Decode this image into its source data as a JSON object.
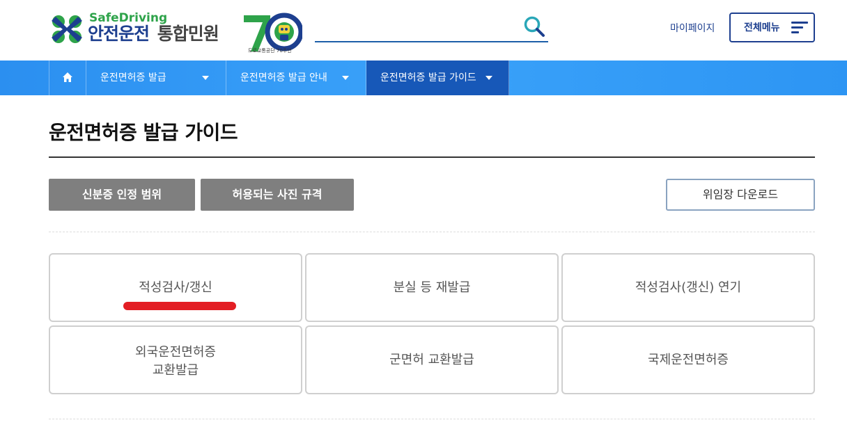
{
  "header": {
    "logo_en": "SafeDriving",
    "logo_ko_main": "안전운전",
    "logo_ko_sub": "통합민원",
    "logo_badge_caption": "도로교통공단 70주년",
    "search_placeholder": "",
    "search_value": "",
    "mypage_label": "마이페이지",
    "allmenu_label": "전체메뉴"
  },
  "nav": {
    "home_icon": "home-icon",
    "items": [
      {
        "label": "운전면허증 발급"
      },
      {
        "label": "운전면허증 발급 안내"
      },
      {
        "label": "운전면허증 발급 가이드"
      }
    ]
  },
  "main": {
    "title": "운전면허증 발급 가이드",
    "buttons": {
      "id_range": "신분증 인정 범위",
      "photo_spec": "허용되는 사진 규격",
      "proxy_download": "위임장 다운로드"
    },
    "cards": [
      {
        "line1": "적성검사/갱신"
      },
      {
        "line1": "분실 등 재발급"
      },
      {
        "line1": "적성검사(갱신) 연기"
      },
      {
        "line1": "외국운전면허증",
        "line2": "교환발급"
      },
      {
        "line1": "군면허 교환발급"
      },
      {
        "line1": "국제운전면허증"
      }
    ]
  },
  "colors": {
    "brand_navy": "#1d3f8f",
    "brand_green": "#2ea34a",
    "nav_blue": "#2b8ff0",
    "nav_active": "#1758b8",
    "button_gray": "#7f7f7f",
    "highlight_red": "#e31e24"
  }
}
